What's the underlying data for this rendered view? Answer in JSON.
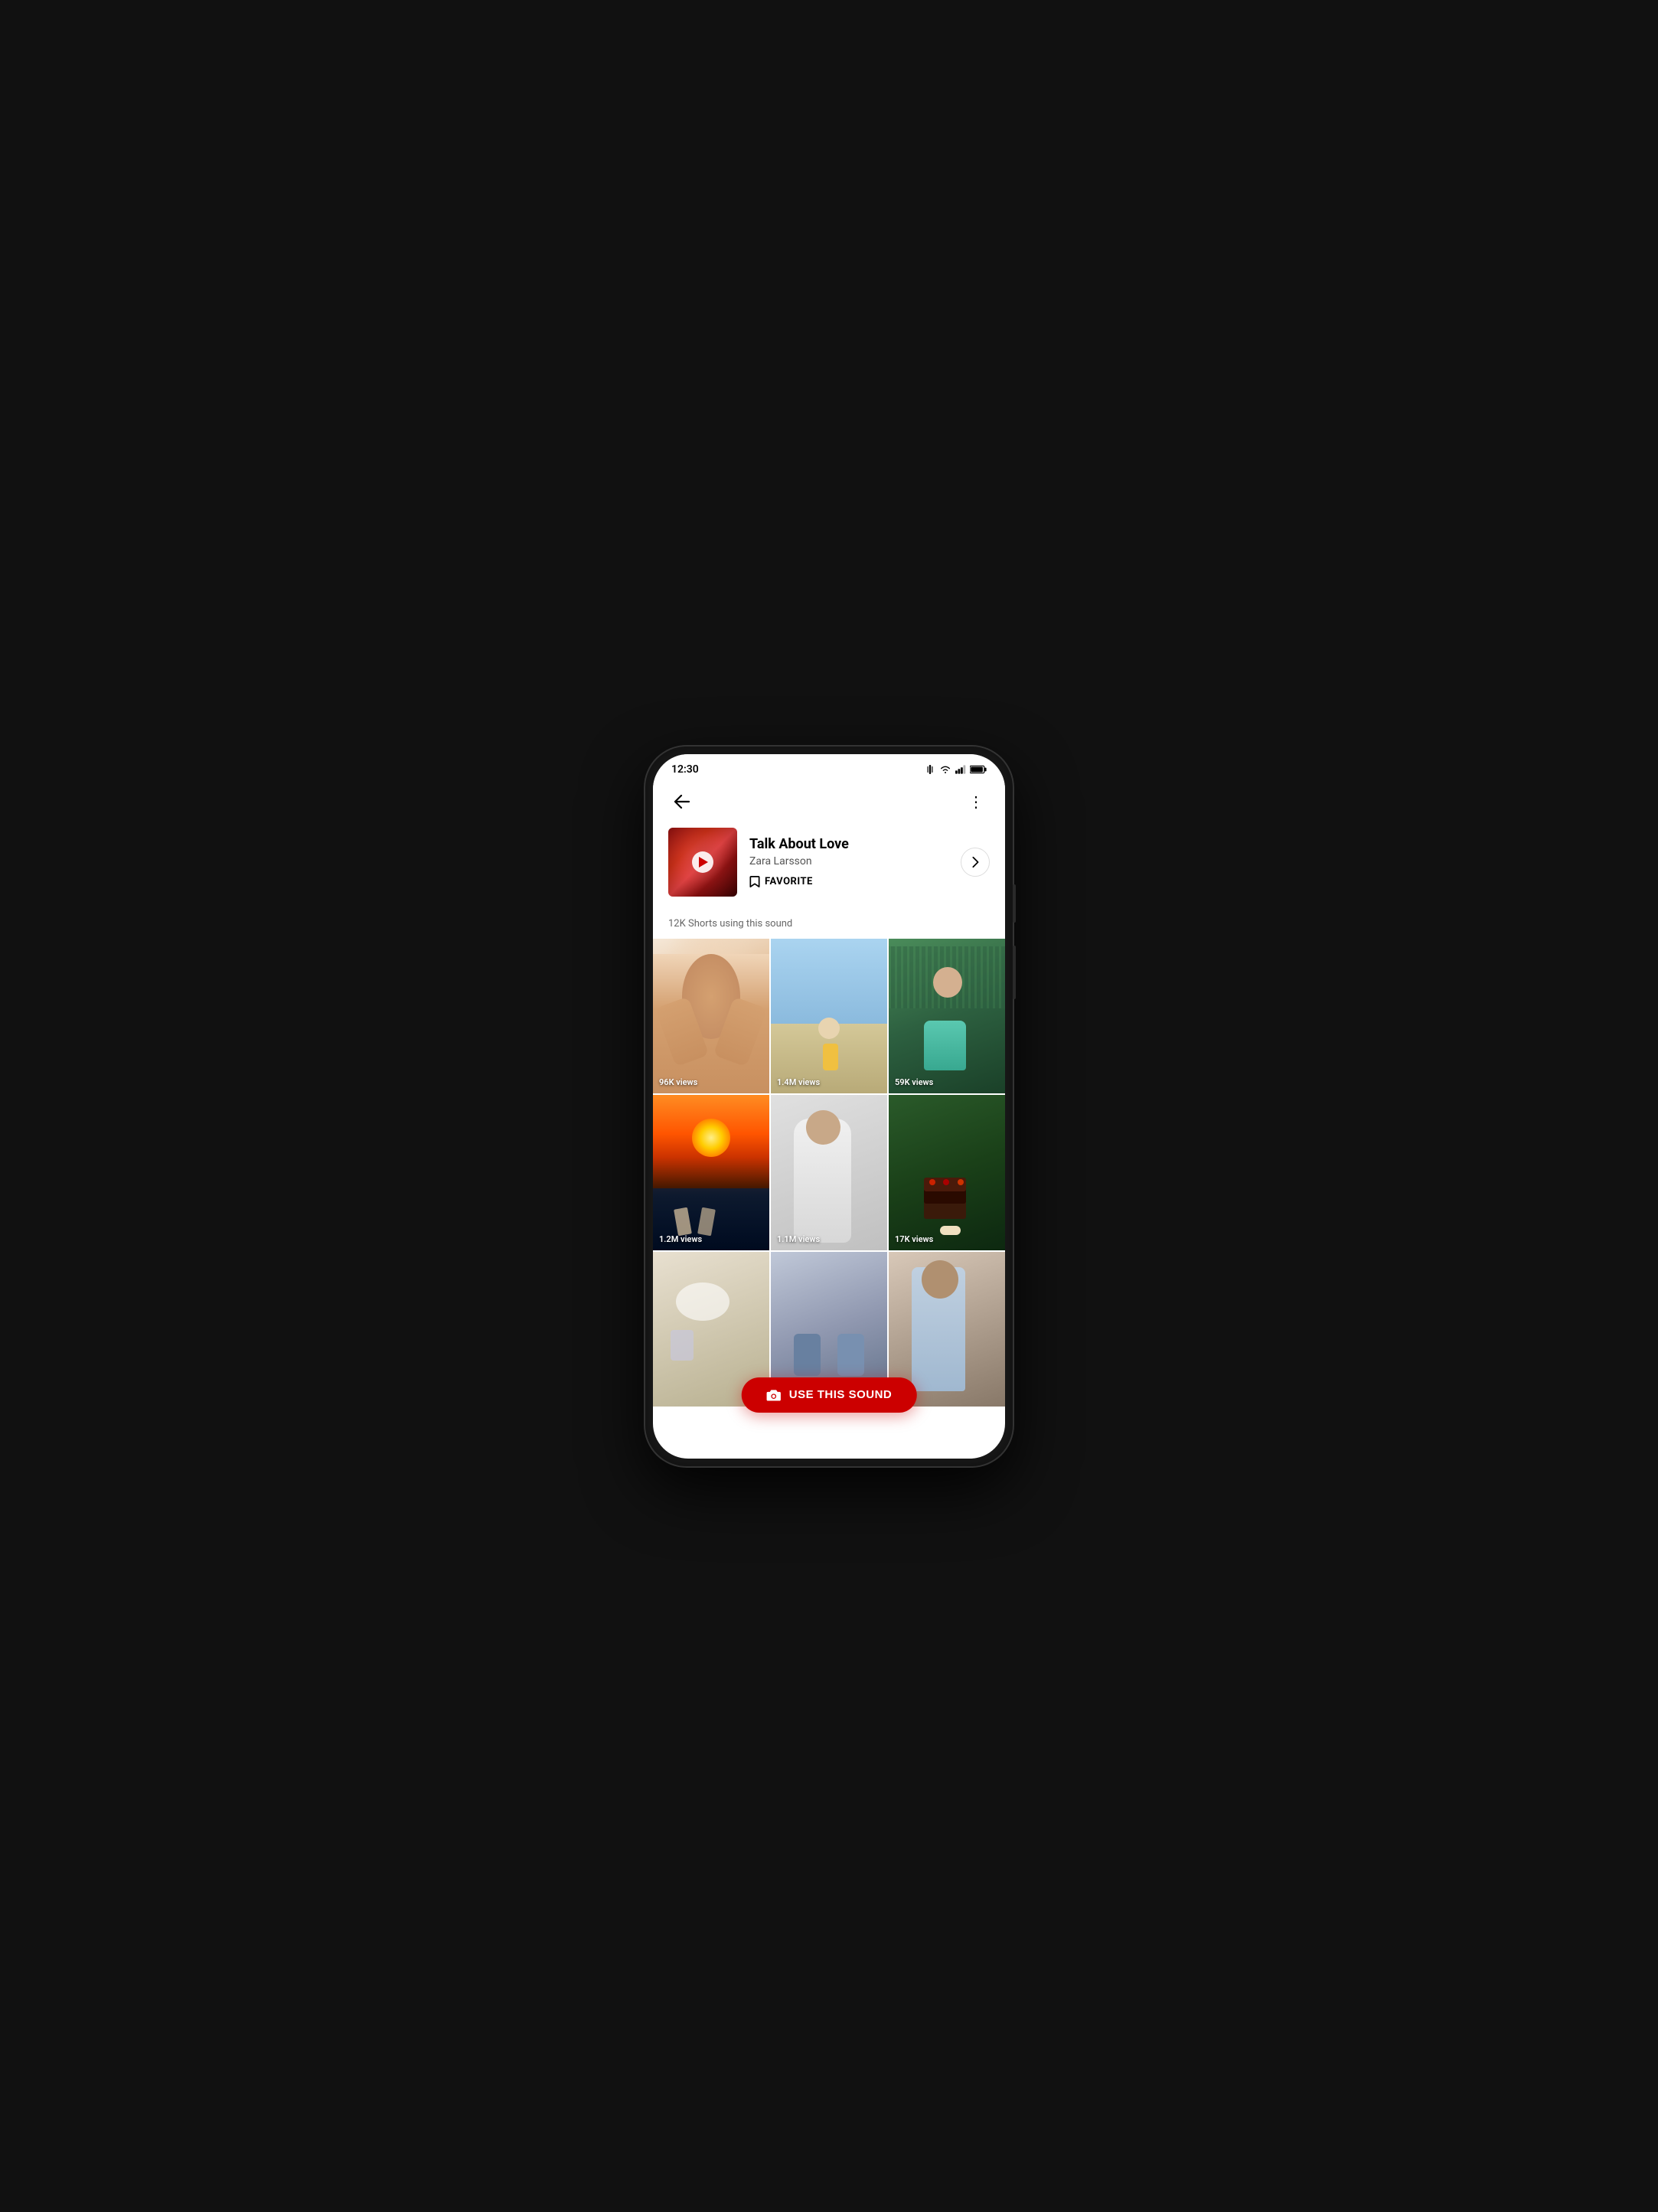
{
  "phone": {
    "status_bar": {
      "time": "12:30",
      "icons": [
        "vibrate",
        "wifi",
        "signal",
        "battery"
      ]
    },
    "nav": {
      "back_label": "←",
      "more_label": "⋮"
    },
    "sound": {
      "title": "Talk About Love",
      "artist": "Zara Larsson",
      "favorite_label": "FAVORITE",
      "chevron_label": "›",
      "stats_text": "12K Shorts using this sound"
    },
    "videos": [
      {
        "id": "v1",
        "views": "96K views",
        "style": "skincare"
      },
      {
        "id": "v2",
        "views": "1.4M views",
        "style": "skater"
      },
      {
        "id": "v3",
        "views": "59K views",
        "style": "garden"
      },
      {
        "id": "v4",
        "views": "1.2M views",
        "style": "sunset"
      },
      {
        "id": "v5",
        "views": "1.1M views",
        "style": "wrapped"
      },
      {
        "id": "v6",
        "views": "17K views",
        "style": "cake"
      },
      {
        "id": "v7",
        "views": "",
        "style": "table"
      },
      {
        "id": "v8",
        "views": "",
        "style": "couple"
      },
      {
        "id": "v9",
        "views": "",
        "style": "man"
      }
    ],
    "cta": {
      "label": "USE THIS SOUND",
      "icon": "camera"
    }
  }
}
